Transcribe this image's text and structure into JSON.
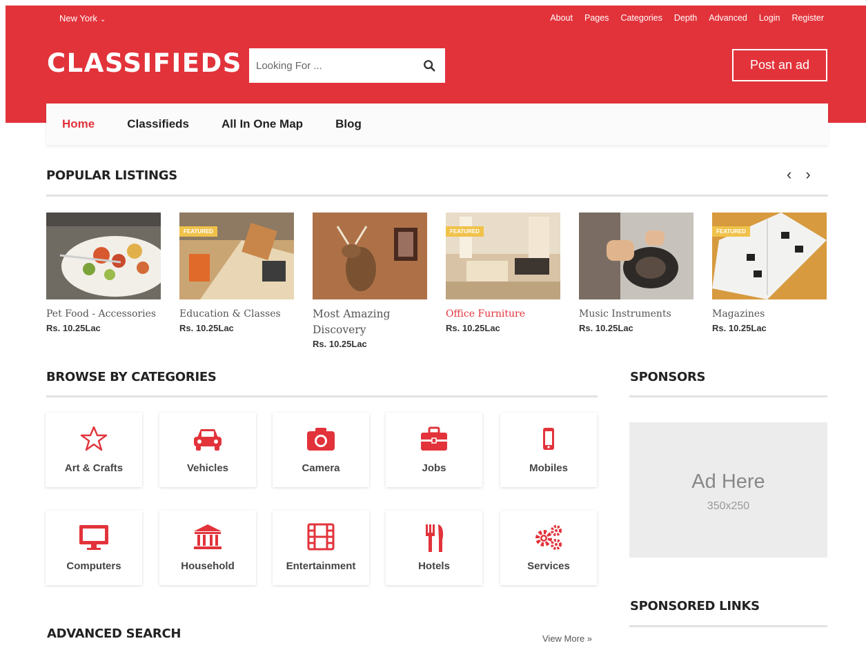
{
  "colors": {
    "brand": "#e2333b",
    "badge": "#f0c24a"
  },
  "topbar": {
    "location": "New York",
    "links": [
      "About",
      "Pages",
      "Categories",
      "Depth",
      "Advanced",
      "Login",
      "Register"
    ]
  },
  "header": {
    "logo": "CLASSIFIEDS",
    "search_placeholder": "Looking For ...",
    "post_button": "Post an ad"
  },
  "nav": [
    "Home",
    "Classifieds",
    "All In One Map",
    "Blog"
  ],
  "popular": {
    "title": "POPULAR LISTINGS",
    "items": [
      {
        "name": "Pet Food - Accessories",
        "price": "Rs. 10.25Lac",
        "badge": ""
      },
      {
        "name": "Education & Classes",
        "price": "Rs. 10.25Lac",
        "badge": "FEATURED"
      },
      {
        "name": "Most Amazing Discovery",
        "price": "Rs. 10.25Lac",
        "badge": ""
      },
      {
        "name": "Office Furniture",
        "price": "Rs. 10.25Lac",
        "badge": "FEATURED"
      },
      {
        "name": "Music Instruments",
        "price": "Rs. 10.25Lac",
        "badge": ""
      },
      {
        "name": "Magazines",
        "price": "Rs. 10.25Lac",
        "badge": "FEATURED"
      }
    ]
  },
  "categories": {
    "title": "BROWSE BY CATEGORIES",
    "items": [
      {
        "label": "Art & Crafts",
        "icon": "star-icon"
      },
      {
        "label": "Vehicles",
        "icon": "car-icon"
      },
      {
        "label": "Camera",
        "icon": "camera-icon"
      },
      {
        "label": "Jobs",
        "icon": "briefcase-icon"
      },
      {
        "label": "Mobiles",
        "icon": "mobile-icon"
      },
      {
        "label": "Computers",
        "icon": "desktop-icon"
      },
      {
        "label": "Household",
        "icon": "bank-icon"
      },
      {
        "label": "Entertainment",
        "icon": "film-icon"
      },
      {
        "label": "Hotels",
        "icon": "cutlery-icon"
      },
      {
        "label": "Services",
        "icon": "gears-icon"
      }
    ]
  },
  "sponsors": {
    "title": "SPONSORS",
    "ad_title": "Ad Here",
    "ad_size": "350x250"
  },
  "sponsored_links": {
    "title": "SPONSORED LINKS"
  },
  "advanced_search": {
    "title": "ADVANCED SEARCH",
    "view_more": "View More »"
  }
}
